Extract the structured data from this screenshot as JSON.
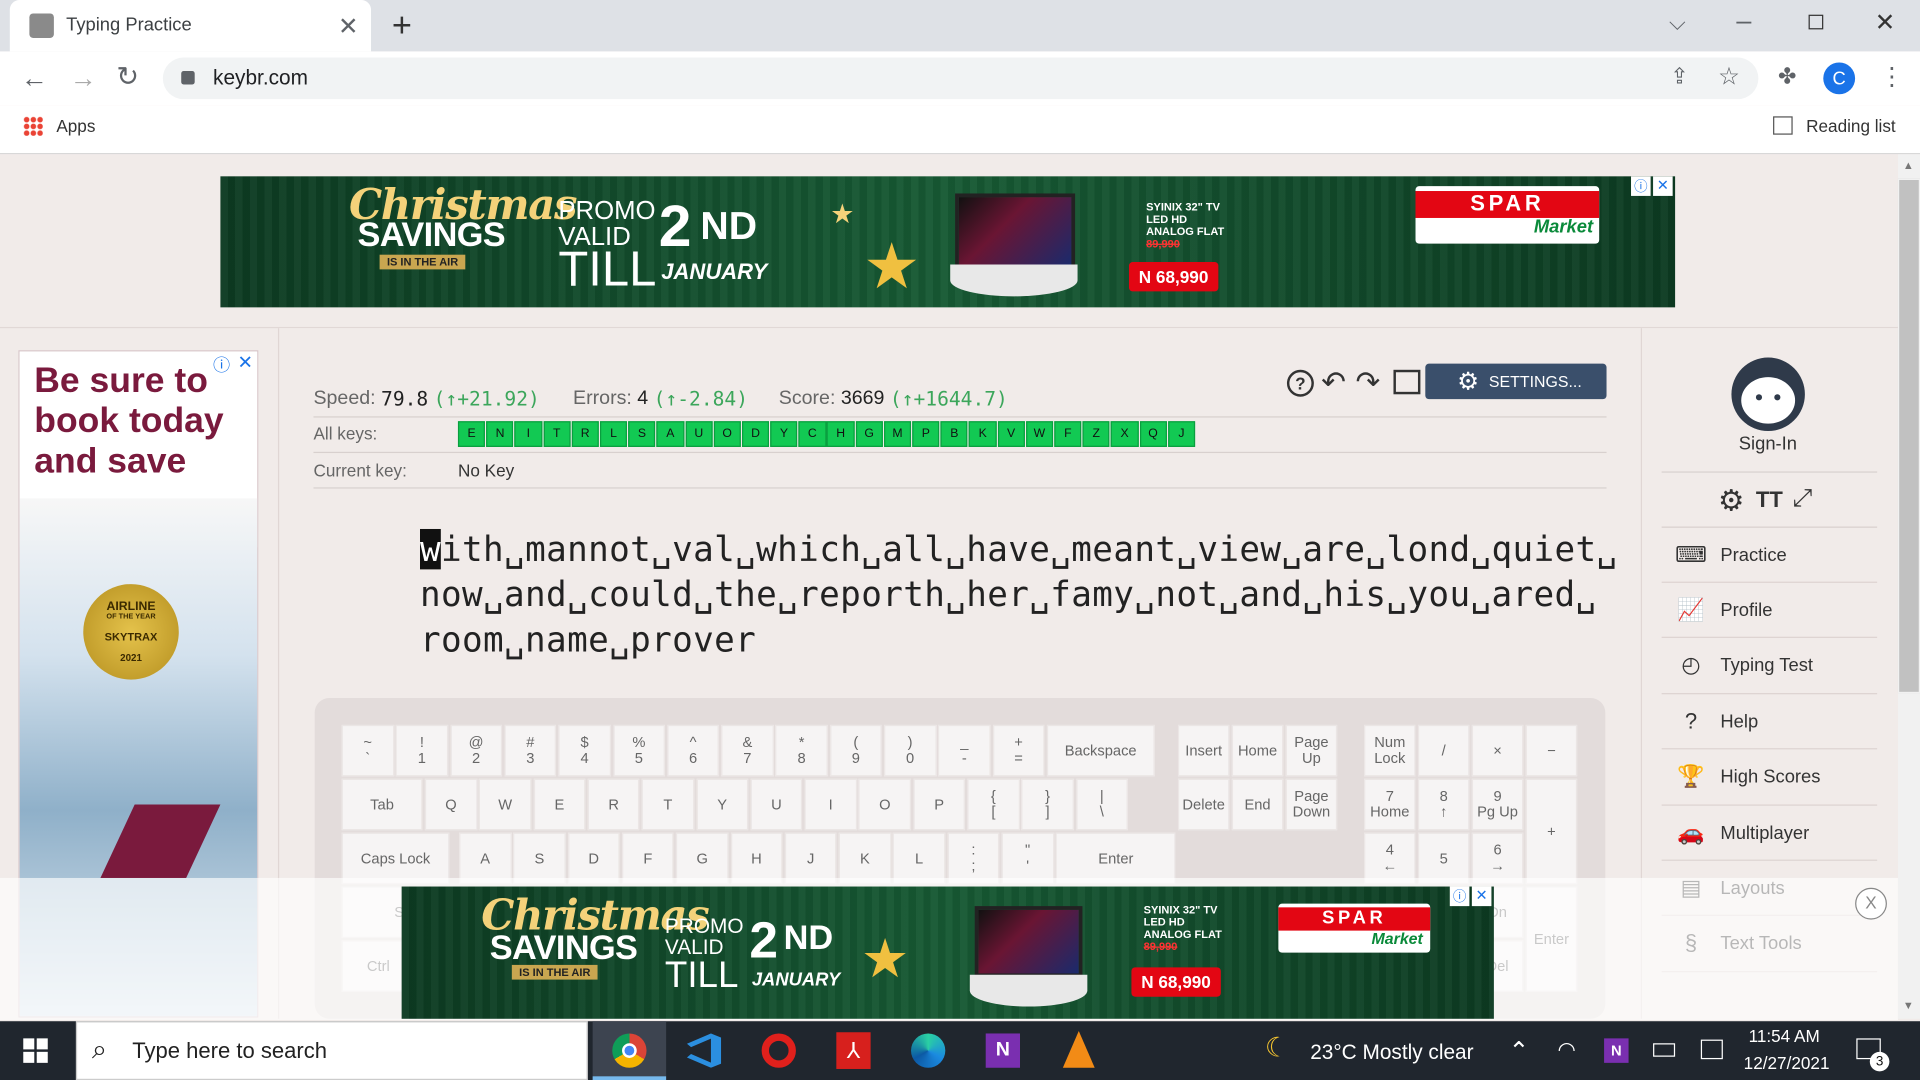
{
  "browser": {
    "tab_title": "Typing Practice",
    "url": "keybr.com",
    "bookmarks": {
      "apps": "Apps",
      "reading_list": "Reading list"
    },
    "profile_initial": "C"
  },
  "ad_top": {
    "title1": "Christmas",
    "title2": "SAVINGS",
    "tag": "IS IN THE AIR",
    "promo1": "PROMO",
    "promo2": "VALID",
    "till": "TILL",
    "day": "2",
    "sup": "ND",
    "month": "JANUARY",
    "product1": "SYINIX 32\" TV",
    "product2": "LED HD",
    "product3": "ANALOG FLAT",
    "old_price": "89,990",
    "new_price": "N 68,990",
    "brand": "SPAR",
    "brand_sub": "Market"
  },
  "ad_side": {
    "text1": "Be sure to",
    "text2": "book today",
    "text3": "and save",
    "badge1": "AIRLINE",
    "badge2": "OF THE YEAR",
    "badge3": "SKYTRAX",
    "badge4": "2021"
  },
  "stats": {
    "speed_label": "Speed:",
    "speed_value": "79.8",
    "speed_delta": "(↑+21.92)",
    "errors_label": "Errors:",
    "errors_value": "4",
    "errors_delta": "(↑-2.84)",
    "score_label": "Score:",
    "score_value": "3669",
    "score_delta": "(↑+1644.7)",
    "all_keys_label": "All keys:",
    "keys": [
      "E",
      "N",
      "I",
      "T",
      "R",
      "L",
      "S",
      "A",
      "U",
      "O",
      "D",
      "Y",
      "C",
      "H",
      "G",
      "M",
      "P",
      "B",
      "K",
      "V",
      "W",
      "F",
      "Z",
      "X",
      "Q",
      "J"
    ],
    "current_key_label": "Current key:",
    "current_key_value": "No Key",
    "settings_label": "SETTINGS..."
  },
  "lesson": {
    "cursor_char": "w",
    "line1": "ith␣mannot␣val␣which␣all␣have␣meant␣view␣are␣lond␣quiet␣",
    "line2": "now␣and␣could␣the␣reporth␣her␣famy␣not␣and␣his␣you␣ared␣",
    "line3": "room␣name␣prover"
  },
  "keyboard": {
    "row1": [
      [
        "~",
        "`"
      ],
      [
        "!",
        "1"
      ],
      [
        "@",
        "2"
      ],
      [
        "#",
        "3"
      ],
      [
        "$",
        "4"
      ],
      [
        "%",
        "5"
      ],
      [
        "^",
        "6"
      ],
      [
        "&",
        "7"
      ],
      [
        "*",
        "8"
      ],
      [
        "(",
        "9"
      ],
      [
        ")",
        "0"
      ],
      [
        "_",
        "-"
      ],
      [
        "+",
        "="
      ]
    ],
    "backspace": "Backspace",
    "tab": "Tab",
    "row2": [
      "Q",
      "W",
      "E",
      "R",
      "T",
      "Y",
      "U",
      "I",
      "O",
      "P"
    ],
    "row2b": [
      [
        "{",
        "["
      ],
      [
        "}",
        "]"
      ],
      [
        "|",
        "\\"
      ]
    ],
    "caps": "Caps Lock",
    "row3": [
      "A",
      "S",
      "D",
      "F",
      "G",
      "H",
      "J",
      "K",
      "L"
    ],
    "row3b": [
      [
        ":",
        ";"
      ],
      [
        "\"",
        "'"
      ]
    ],
    "enter": "Enter",
    "shift": "Shift",
    "ctrl": "Ctrl",
    "nav": {
      "insert": "Insert",
      "home": "Home",
      "pgup": "Page Up",
      "delete": "Delete",
      "end": "End",
      "pgdn": "Page Down"
    },
    "numpad": {
      "numlock": "Num Lock",
      "div": "/",
      "mul": "×",
      "minus": "−",
      "n7": "7",
      "n7s": "Home",
      "n8": "8",
      "n8s": "↑",
      "n9": "9",
      "n9s": "Pg Up",
      "plus": "+",
      "n4": "4",
      "n4s": "←",
      "n5": "5",
      "n6": "6",
      "n6s": "→",
      "enter": "Enter",
      "dn": "Dn",
      "del": "Del"
    }
  },
  "nav": {
    "sign_in": "Sign-In",
    "items": [
      {
        "label": "Practice"
      },
      {
        "label": "Profile"
      },
      {
        "label": "Typing Test"
      },
      {
        "label": "Help"
      },
      {
        "label": "High Scores"
      },
      {
        "label": "Multiplayer"
      },
      {
        "label": "Layouts"
      },
      {
        "label": "Text Tools"
      }
    ]
  },
  "taskbar": {
    "search_placeholder": "Type here to search",
    "weather": "23°C  Mostly clear",
    "time": "11:54 AM",
    "date": "12/27/2021",
    "notif_count": "3"
  }
}
